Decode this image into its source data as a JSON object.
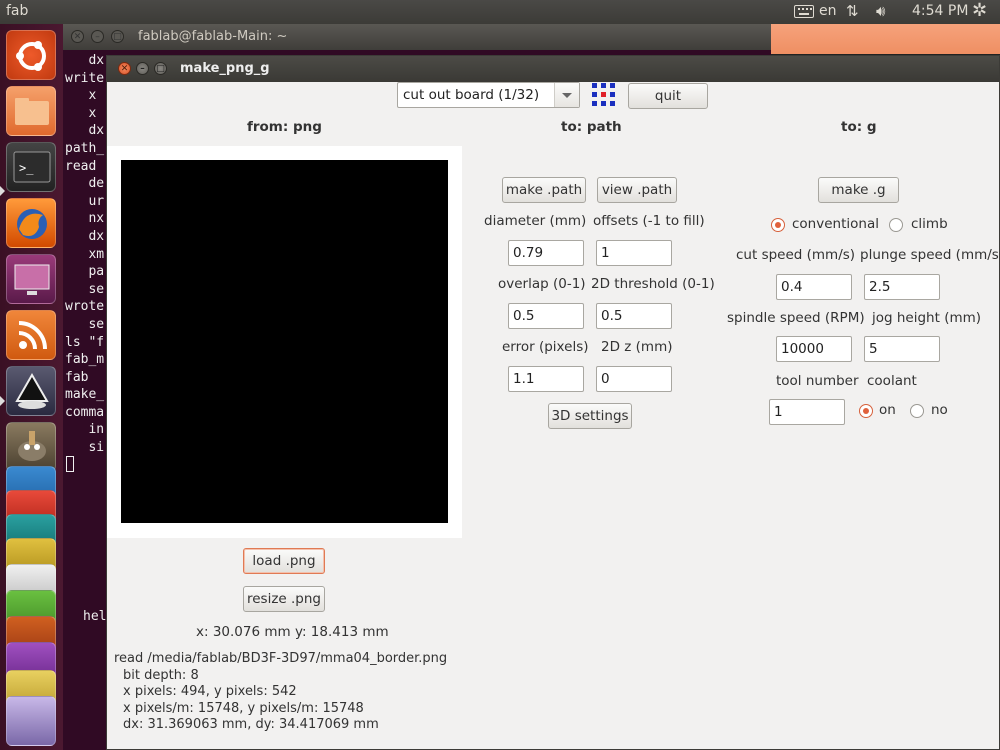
{
  "top_panel": {
    "app_name": "fab",
    "language": "en",
    "clock": "4:54 PM",
    "network_glyph": "⇅",
    "volume_glyph": "🔊︎",
    "settings_glyph": "✲"
  },
  "launcher": {
    "items": [
      {
        "name": "ubuntu-dash",
        "color": "#d84218"
      },
      {
        "name": "files",
        "color": "#e06a2e"
      },
      {
        "name": "terminal",
        "color": "#3a3a3a"
      },
      {
        "name": "firefox",
        "color": "#e66000"
      },
      {
        "name": "workspace-switcher",
        "color": "#7a2a5c"
      },
      {
        "name": "rss",
        "color": "#e06a20"
      },
      {
        "name": "inkscape",
        "color": "#2a2a40"
      },
      {
        "name": "gimp",
        "color": "#6a6050"
      },
      {
        "name": "stacked-apps",
        "color": "#c24a2a"
      }
    ]
  },
  "terminal": {
    "title": "fablab@fablab-Main: ~",
    "lines": [
      "   dx",
      "write",
      "   x",
      "   x",
      "   dx",
      "path_",
      "read",
      "   de",
      "   ur",
      "   nx",
      "   dx",
      "   xm",
      "   pa",
      "   se",
      "wrote",
      "   se",
      "ls \"f",
      "fab_m",
      "fab",
      "make_",
      "comma",
      "   in",
      "   si"
    ],
    "tail": "hell"
  },
  "window": {
    "title": "make_png_g",
    "mode_select": "cut out board (1/32)",
    "quit_label": "quit",
    "from_header": "from: png",
    "path_header": "to: path",
    "g_header": "to: g",
    "load_label": "load .png",
    "resize_label": "resize .png",
    "coords": "x: 30.076 mm  y: 18.413 mm",
    "info_lines": [
      "read /media/fablab/BD3F-3D97/mma04_border.png",
      "bit depth: 8",
      "x pixels: 494, y pixels: 542",
      "x pixels/m: 15748, y pixels/m: 15748",
      "dx: 31.369063 mm, dy: 34.417069 mm"
    ]
  },
  "path_panel": {
    "make_path_label": "make .path",
    "view_path_label": "view .path",
    "diameter_label": "diameter (mm)",
    "diameter_value": "0.79",
    "offsets_label": "offsets (-1 to fill)",
    "offsets_value": "1",
    "overlap_label": "overlap (0-1)",
    "overlap_value": "0.5",
    "threshold_label": "2D threshold (0-1)",
    "threshold_value": "0.5",
    "error_label": "error (pixels)",
    "error_value": "1.1",
    "z_label": "2D z (mm)",
    "z_value": "0",
    "settings_3d_label": "3D settings"
  },
  "g_panel": {
    "make_g_label": "make .g",
    "conventional_label": "conventional",
    "climb_label": "climb",
    "direction_selected": "conventional",
    "cut_speed_label": "cut speed (mm/s)",
    "cut_speed_value": "0.4",
    "plunge_speed_label": "plunge speed (mm/s)",
    "plunge_speed_value": "2.5",
    "spindle_label": "spindle speed (RPM)",
    "spindle_value": "10000",
    "jog_label": "jog height (mm)",
    "jog_value": "5",
    "tool_label": "tool number",
    "tool_value": "1",
    "coolant_label": "coolant",
    "coolant_on_label": "on",
    "coolant_off_label": "no",
    "coolant_selected": "on"
  },
  "colors": {
    "accent": "#e0613c",
    "desktop_bg": "#2c001e",
    "terminal_bg": "#300a24",
    "window_bg": "#f2f1f0"
  }
}
